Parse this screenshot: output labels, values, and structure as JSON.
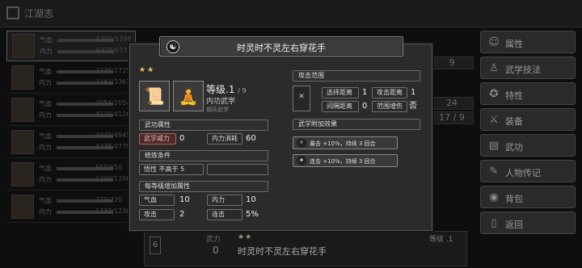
{
  "topbar": {
    "title": "江湖志"
  },
  "roster": [
    {
      "l1": "气血",
      "v1": "5399/5399",
      "l2": "内力",
      "v2": "6779/6779"
    },
    {
      "l1": "气血",
      "v1": "2725/2725",
      "l2": "内力",
      "v2": "3361/3361"
    },
    {
      "l1": "气血",
      "v1": "2054/2054",
      "l2": "内力",
      "v2": "4120/4120"
    },
    {
      "l1": "气血",
      "v1": "4945/4945",
      "l2": "内力",
      "v2": "4778/4778"
    },
    {
      "l1": "气血",
      "v1": "650/650",
      "l2": "内力",
      "v2": "1200/1200"
    },
    {
      "l1": "气血",
      "v1": "720/720",
      "l2": "内力",
      "v2": "1230/1230"
    }
  ],
  "menu": [
    {
      "label": "属性",
      "icon": "person-icon"
    },
    {
      "label": "武学技法",
      "icon": "martial-icon"
    },
    {
      "label": "特性",
      "icon": "trait-icon"
    },
    {
      "label": "装备",
      "icon": "sword-icon"
    },
    {
      "label": "武功",
      "icon": "book-icon"
    },
    {
      "label": "人物传记",
      "icon": "scroll-icon"
    },
    {
      "label": "背包",
      "icon": "bag-icon"
    },
    {
      "label": "返回",
      "icon": "back-icon"
    }
  ],
  "bgstats": [
    "9",
    "24",
    "17 / 9"
  ],
  "bottom": {
    "slot": "6",
    "points_label": "武力",
    "points": "0",
    "stars": "★★",
    "name": "时灵时不灵左右穿花手",
    "level": "等级 .1"
  },
  "modal": {
    "title": "时灵时不灵左右穿花手",
    "stars": "★★",
    "level": "等级.1",
    "level_max": "/ 9",
    "type": "内功武学",
    "owner": "佣兵武学",
    "sec_attr": "武功属性",
    "attr_power_label": "武学威力",
    "attr_power_value": "0",
    "attr_cost_label": "内力消耗",
    "attr_cost_value": "60",
    "sec_train": "修炼条件",
    "train_req": "悟性 不高于 5",
    "sec_bonus": "每等级增加属性",
    "bonus": [
      {
        "label": "气血",
        "value": "10"
      },
      {
        "label": "内力",
        "value": "10"
      },
      {
        "label": "攻击",
        "value": "2"
      },
      {
        "label": "连击",
        "value": "5%"
      }
    ],
    "sec_range": "攻击范围",
    "range": [
      {
        "label": "选择距离",
        "value": "1"
      },
      {
        "label": "攻击距离",
        "value": "1"
      },
      {
        "label": "间隔距离",
        "value": "0"
      },
      {
        "label": "范围增伤",
        "value": "否"
      }
    ],
    "sec_effect": "武学附加效果",
    "effects": [
      {
        "icon": "lightning-icon",
        "text": "暴击 +10%，持续 3 回合"
      },
      {
        "icon": "combo-icon",
        "text": "连击 +10%，持续 3 回合"
      }
    ]
  }
}
